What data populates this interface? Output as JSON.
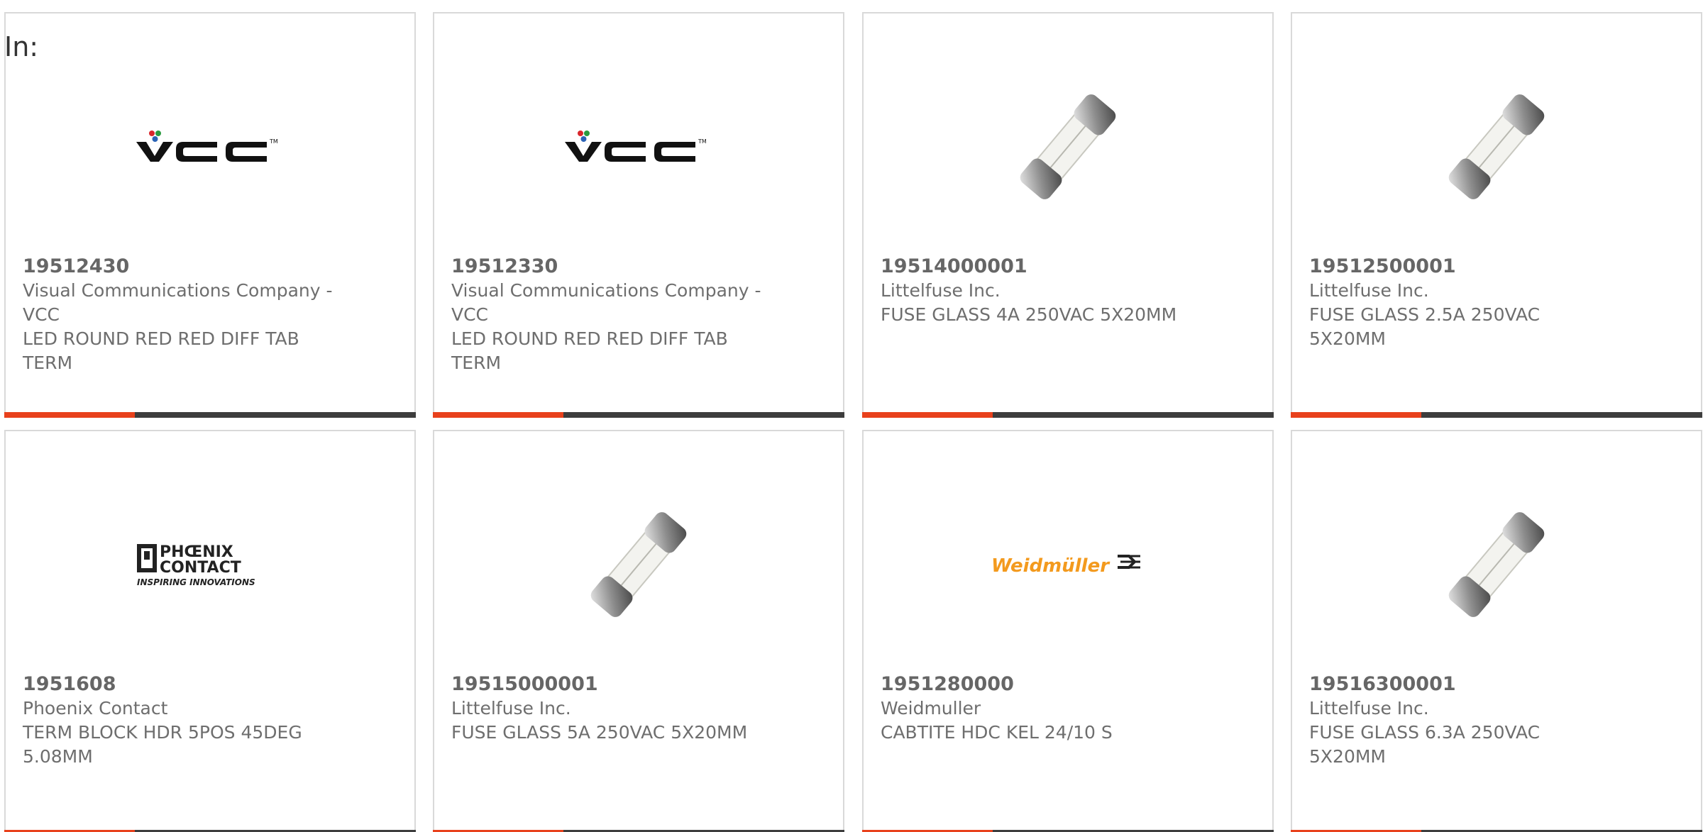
{
  "filter": {
    "label": "In:"
  },
  "products": [
    {
      "part_number": "19512430",
      "manufacturer": "Visual Communications Company - VCC",
      "description": "LED ROUND RED RED DIFF TAB TERM",
      "image": "vcc-logo"
    },
    {
      "part_number": "19512330",
      "manufacturer": "Visual Communications Company - VCC",
      "description": "LED ROUND RED RED DIFF TAB TERM",
      "image": "vcc-logo"
    },
    {
      "part_number": "19514000001",
      "manufacturer": "Littelfuse Inc.",
      "description": "FUSE GLASS 4A 250VAC 5X20MM",
      "image": "glass-fuse"
    },
    {
      "part_number": "19512500001",
      "manufacturer": "Littelfuse Inc.",
      "description": "FUSE GLASS 2.5A 250VAC 5X20MM",
      "image": "glass-fuse"
    },
    {
      "part_number": "1951608",
      "manufacturer": "Phoenix Contact",
      "description": "TERM BLOCK HDR 5POS 45DEG 5.08MM",
      "image": "phoenix-contact-logo"
    },
    {
      "part_number": "19515000001",
      "manufacturer": "Littelfuse Inc.",
      "description": "FUSE GLASS 5A 250VAC 5X20MM",
      "image": "glass-fuse"
    },
    {
      "part_number": "1951280000",
      "manufacturer": "Weidmuller",
      "description": "CABTITE HDC KEL 24/10 S",
      "image": "weidmuller-logo"
    },
    {
      "part_number": "19516300001",
      "manufacturer": "Littelfuse Inc.",
      "description": "FUSE GLASS 6.3A 250VAC 5X20MM",
      "image": "glass-fuse"
    }
  ],
  "logos": {
    "vcc": "VCC",
    "vcc_tm": "TM",
    "phoenix_line1": "PHŒNIX",
    "phoenix_line2": "CONTACT",
    "phoenix_tagline": "INSPIRING INNOVATIONS",
    "weidmuller": "Weidmüller"
  },
  "colors": {
    "accent": "#e8411c",
    "bar": "#3d3d3d",
    "text": "#6e6e6e",
    "border": "#d9d9d9",
    "weidmuller_orange": "#f39a1e"
  }
}
